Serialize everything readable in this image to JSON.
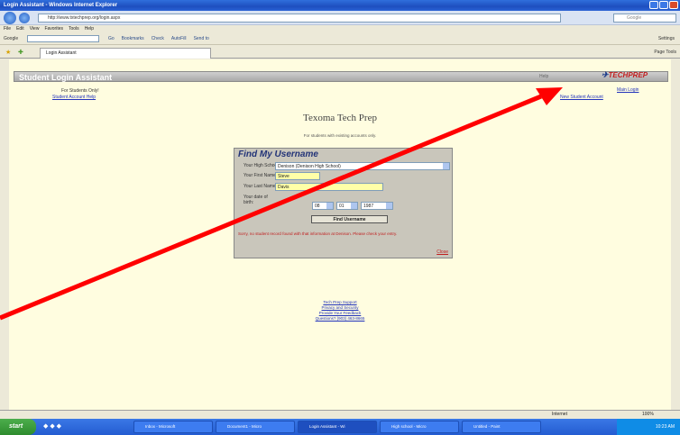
{
  "window": {
    "title": "Login Assistant - Windows Internet Explorer",
    "address": "http://www.txtechprep.org/login.aspx",
    "search_placeholder": "Google",
    "menu": [
      "File",
      "Edit",
      "View",
      "Favorites",
      "Tools",
      "Help"
    ],
    "toolbar_label": "Google",
    "toolbar_items": [
      "Go",
      "Bookmarks",
      "Check",
      "AutoFill",
      "Send to"
    ],
    "toolbar_right": "Settings",
    "tab_label": "Login Assistant",
    "tab_tools": "Page  Tools"
  },
  "page": {
    "header_title": "Student Login Assistant",
    "header_help": "Help",
    "logo_text": "TECHPREP",
    "for_students": "For Students Only!",
    "link_student_account_help": "Student Account Help",
    "link_main_login": "Main Login",
    "link_new_student_account": "New Student Account",
    "school_title": "Texoma Tech Prep",
    "school_sub": "For students with existing accounts only.",
    "find_panel": {
      "title": "Find My Username",
      "high_school_label": "Your High School:",
      "high_school_value": "Denison (Denison High School)",
      "first_name_label": "Your First Name:",
      "first_name_value": "Steve",
      "last_name_label": "Your Last Name:",
      "last_name_value": "Davis",
      "dob_label": "Your date of birth:",
      "dob_month": "08",
      "dob_day": "01",
      "dob_year": "1987",
      "find_button": "Find Username",
      "error_message": "Sorry, no student record found with that information at Denison. Please check your entry.",
      "close_link": "Close"
    },
    "footer_links": [
      "Tech Prep Support",
      "Privacy and Security",
      "Provide Your Feedback",
      "Questions? (903) 463-8665"
    ]
  },
  "statusbar": {
    "left": "",
    "zone": "Internet",
    "zoom": "100%"
  },
  "taskbar": {
    "start_label": "start",
    "buttons": [
      "Inbox - Microsoft",
      "Document1 - Micro",
      "Login Assistant - Wi",
      "High school - Micro",
      "Untitled - Paint"
    ],
    "clock": "10:23 AM"
  },
  "colors": {
    "annotation_arrow": "#ff0000",
    "page_bg": "#fffde0",
    "panel_bg": "#c9c6bb",
    "error_text": "#c02020"
  }
}
